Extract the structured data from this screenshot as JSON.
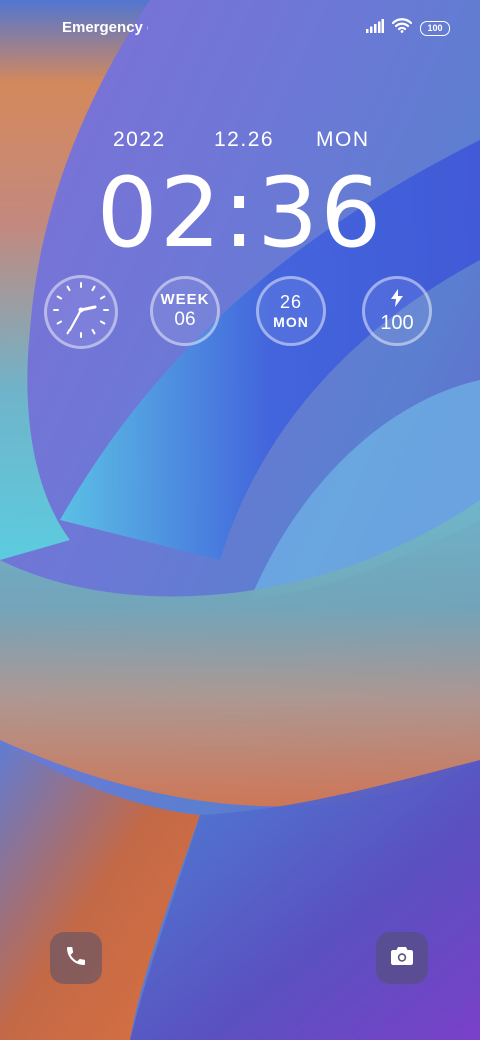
{
  "status_bar": {
    "carrier_text": "Emergency c",
    "battery_level": "100",
    "icons": [
      "signal-icon",
      "wifi-icon",
      "battery-icon"
    ]
  },
  "lockscreen": {
    "date": {
      "year": "2022",
      "month_day": "12.26",
      "weekday": "MON"
    },
    "time": "02:36",
    "widgets": {
      "analog_clock": {
        "icon": "analog-clock-icon"
      },
      "week": {
        "label": "WEEK",
        "value": "06"
      },
      "day": {
        "value": "26",
        "label": "MON"
      },
      "battery": {
        "icon": "charging-bolt-icon",
        "value": "100"
      }
    }
  },
  "shortcuts": {
    "left": {
      "icon": "phone-icon"
    },
    "right": {
      "icon": "camera-icon"
    }
  },
  "colors": {
    "accent_blue": "#3f56d8",
    "wallpaper_orange": "#e07a4a",
    "wallpaper_teal": "#6cc6d8",
    "wallpaper_purple": "#6a4fc8"
  }
}
